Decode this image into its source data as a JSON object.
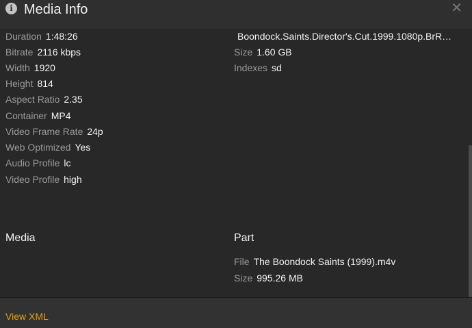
{
  "header": {
    "title": "Media Info",
    "info_icon": "info-circle-icon",
    "close_icon": "close-icon"
  },
  "stream": {
    "fields": [
      {
        "label": "Duration",
        "value": "1:48:26"
      },
      {
        "label": "Bitrate",
        "value": "2116 kbps"
      },
      {
        "label": "Width",
        "value": "1920"
      },
      {
        "label": "Height",
        "value": "814"
      },
      {
        "label": "Aspect Ratio",
        "value": "2.35"
      },
      {
        "label": "Container",
        "value": "MP4"
      },
      {
        "label": "Video Frame Rate",
        "value": "24p"
      },
      {
        "label": "Web Optimized",
        "value": "Yes"
      },
      {
        "label": "Audio Profile",
        "value": "lc"
      },
      {
        "label": "Video Profile",
        "value": "high"
      }
    ]
  },
  "right_top": {
    "file_name": "Boondock.Saints.Director's.Cut.1999.1080p.BrR…",
    "fields": [
      {
        "label": "Size",
        "value": "1.60 GB"
      },
      {
        "label": "Indexes",
        "value": "sd"
      }
    ]
  },
  "media_section": {
    "heading": "Media"
  },
  "part_section": {
    "heading": "Part",
    "fields": [
      {
        "label": "File",
        "value": "The Boondock Saints (1999).m4v"
      },
      {
        "label": "Size",
        "value": "995.26 MB"
      }
    ]
  },
  "footer": {
    "view_xml_label": "View XML"
  },
  "colors": {
    "accent": "#e5a00d",
    "background": "#282828",
    "label": "#9a9a9a",
    "value": "#f2f2f2"
  }
}
